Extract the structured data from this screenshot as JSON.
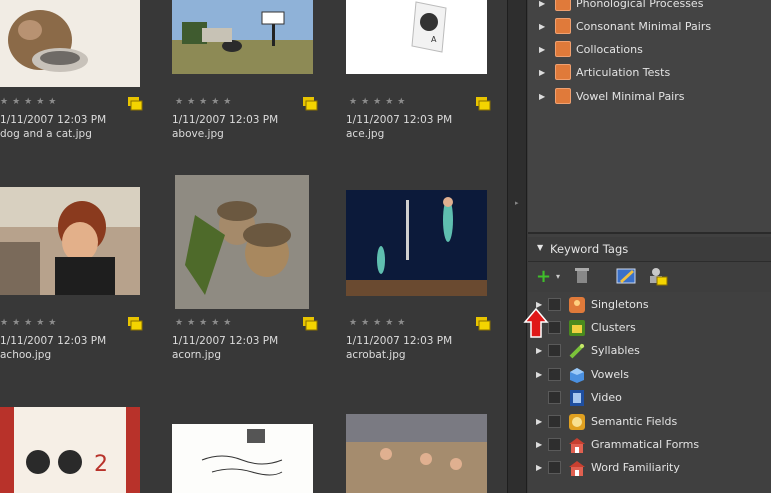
{
  "thumbnails": [
    {
      "date": "1/11/2007 12:03 PM",
      "name": "dog and a cat.jpg",
      "stars": "★★★★★"
    },
    {
      "date": "1/11/2007 12:03 PM",
      "name": "above.jpg",
      "stars": "★★★★★"
    },
    {
      "date": "1/11/2007 12:03 PM",
      "name": "ace.jpg",
      "stars": "★★★★★"
    },
    {
      "date": "1/11/2007 12:03 PM",
      "name": "achoo.jpg",
      "stars": "★★★★★"
    },
    {
      "date": "1/11/2007 12:03 PM",
      "name": "acorn.jpg",
      "stars": "★★★★★"
    },
    {
      "date": "1/11/2007 12:03 PM",
      "name": "acrobat.jpg",
      "stars": "★★★★★"
    }
  ],
  "collections": [
    {
      "label": "Phonological Processes"
    },
    {
      "label": "Consonant Minimal Pairs"
    },
    {
      "label": "Collocations"
    },
    {
      "label": "Articulation Tests"
    },
    {
      "label": "Vowel Minimal Pairs"
    }
  ],
  "keyword_panel": {
    "title": "Keyword Tags",
    "toolbar": {
      "add_icon": "plus-icon",
      "delete_icon": "trash-icon",
      "edit_icon": "pencil-icon",
      "manage_icon": "tag-people-icon"
    }
  },
  "keywords": [
    {
      "label": "Singletons",
      "icon": "singletons-icon"
    },
    {
      "label": "Clusters",
      "icon": "clusters-icon"
    },
    {
      "label": "Syllables",
      "icon": "syllables-icon"
    },
    {
      "label": "Vowels",
      "icon": "vowels-icon"
    },
    {
      "label": "Video",
      "icon": "video-icon"
    },
    {
      "label": "Semantic Fields",
      "icon": "semantic-fields-icon"
    },
    {
      "label": "Grammatical Forms",
      "icon": "grammatical-forms-icon"
    },
    {
      "label": "Word Familiarity",
      "icon": "word-familiarity-icon"
    }
  ],
  "colors": {
    "accent_orange": "#e07a3a",
    "panel_bg": "#404040",
    "grid_bg": "#383838"
  }
}
